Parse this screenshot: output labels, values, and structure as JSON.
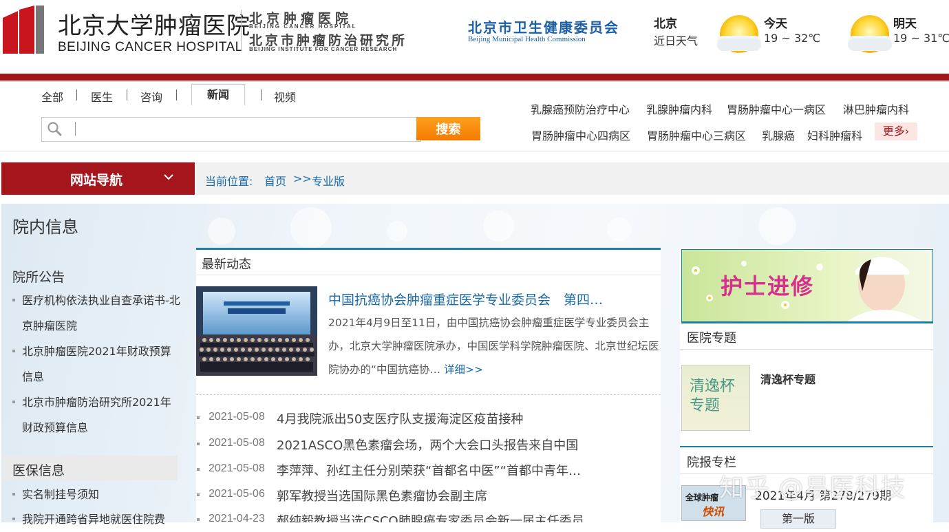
{
  "header": {
    "logo_cn": "北京大学肿瘤医院",
    "logo_en": "BEIJING CANCER HOSPITAL",
    "inst_cn_1": "北京肿瘤医院",
    "inst_en_1": "BEIJING CANCER HOSPITAL",
    "inst_cn_2": "北京市肿瘤防治研究所",
    "inst_en_2": "BEIJING INSTITUTE FOR CANCER RESEARCH",
    "commission_cn": "北京市卫生健康委员会",
    "commission_en": "Beijing Municipal Health Commission",
    "weather": {
      "city": "北京",
      "recent_label": "近日天气",
      "today_label": "今天",
      "today_temp": "19 ~ 32℃",
      "tomorrow_label": "明天",
      "tomorrow_temp": "19 ~ 31℃",
      "icon": "sun-icon"
    }
  },
  "search": {
    "tabs": [
      "全部",
      "医生",
      "咨询",
      "新闻",
      "视频"
    ],
    "active_tab": "新闻",
    "placeholder": "",
    "button_label": "搜索",
    "hot_links_row1": [
      "乳腺癌预防治疗中心",
      "乳腺肿瘤内科",
      "胃肠肿瘤中心一病区",
      "淋巴肿瘤内科"
    ],
    "hot_links_row2": [
      "胃肠肿瘤中心四病区",
      "胃肠肿瘤中心三病区",
      "乳腺癌",
      "妇科肿瘤科"
    ],
    "more_label": "更多›"
  },
  "nav": {
    "site_nav_label": "网站导航",
    "breadcrumb_prefix": "当前位置:",
    "breadcrumb_home": "首页",
    "breadcrumb_sep": ">>",
    "breadcrumb_current": "专业版"
  },
  "left": {
    "title": "院内信息",
    "announce_title": "院所公告",
    "announcements": [
      "医疗机构依法执业自查承诺书-北京肿瘤医院",
      "北京肿瘤医院2021年财政预算信息",
      "北京市肿瘤防治研究所2021年财政预算信息"
    ],
    "insurance_title": "医保信息",
    "insurance_items": [
      "实名制挂号须知",
      "我院开通跨省异地就医住院费"
    ]
  },
  "center": {
    "section_title": "最新动态",
    "featured": {
      "title": "中国抗癌协会肿瘤重症医学专业委员会　第四…",
      "body": "2021年4月9日至11日，由中国抗癌协会肿瘤重症医学专业委员会主办，北京大学肿瘤医院承办，中国医学科学院肿瘤医院、北京世纪坛医院协办的“中国抗癌协…",
      "more": "详细>>"
    },
    "news": [
      {
        "date": "2021-05-08",
        "title": "4月我院派出50支医疗队支援海淀区疫苗接种"
      },
      {
        "date": "2021-05-08",
        "title": "2021ASCO黑色素瘤会场，两个大会口头报告来自中国"
      },
      {
        "date": "2021-05-08",
        "title": "李萍萍、孙红主任分别荣获“首都名中医”“首都中青年…"
      },
      {
        "date": "2021-05-06",
        "title": "郭军教授当选国际黑色素瘤协会副主席"
      },
      {
        "date": "2021-04-23",
        "title": "郝纯毅教授当选CSCO肺腺癌专家委员会新一届主任委员"
      }
    ]
  },
  "right": {
    "banner_text": "护士进修",
    "topics_title": "医院专题",
    "topic_thumb_text": "清逸杯专题",
    "topic_title": "清逸杯专题",
    "paper_title": "院报专栏",
    "paper_thumb_text_1": "全球肿瘤",
    "paper_thumb_text_2": "快讯",
    "paper_issue": "2021年4月 第278/279期",
    "page_button": "第一版"
  },
  "watermark": "知乎 @易医科技",
  "colors": {
    "brand_red": "#a4151c",
    "accent_blue": "#1a6aa6",
    "search_orange": "#f47b00"
  }
}
